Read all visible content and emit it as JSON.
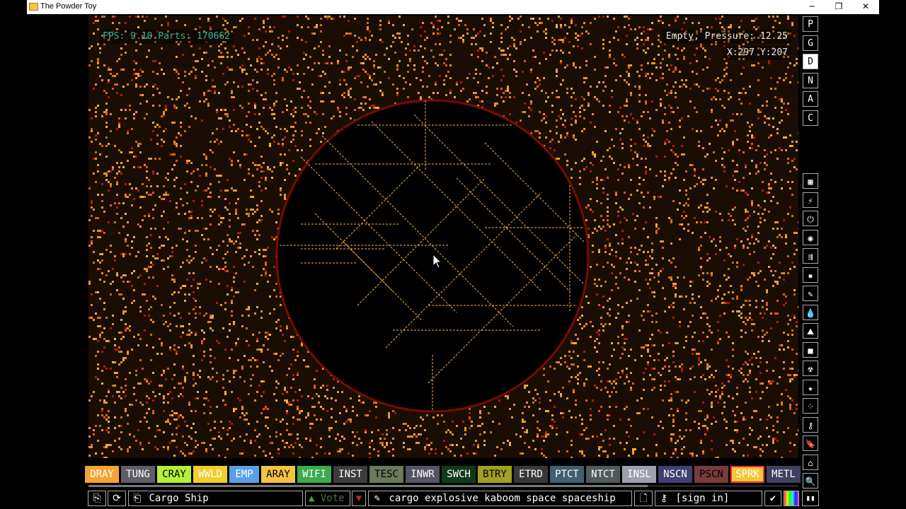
{
  "window": {
    "title": "The Powder Toy",
    "minimize": "─",
    "restore": "❐",
    "close": "✕"
  },
  "hud": {
    "fps_text": "FPS: 9.10 Parts: 170662",
    "info_text": "Empty, Pressure: 12.25",
    "coords_text": "X:297 Y:207"
  },
  "right_toolbar": {
    "modes": [
      "P",
      "G",
      "D",
      "N",
      "A",
      "C"
    ],
    "selected_mode": "D",
    "categories": [
      {
        "name": "walls-icon",
        "glyph": "▦"
      },
      {
        "name": "electronics-icon",
        "glyph": "⚡"
      },
      {
        "name": "powered-icon",
        "glyph": "⏻"
      },
      {
        "name": "sensors-icon",
        "glyph": "◉"
      },
      {
        "name": "force-icon",
        "glyph": "⇶"
      },
      {
        "name": "explosives-icon",
        "glyph": "✸"
      },
      {
        "name": "gases-icon",
        "glyph": "✎"
      },
      {
        "name": "liquids-icon",
        "glyph": "💧"
      },
      {
        "name": "powders-icon",
        "glyph": "⛰"
      },
      {
        "name": "solids-icon",
        "glyph": "■"
      },
      {
        "name": "radioactive-icon",
        "glyph": "☢"
      },
      {
        "name": "special-icon",
        "glyph": "★"
      },
      {
        "name": "life-icon",
        "glyph": "⁘"
      },
      {
        "name": "tools-icon",
        "glyph": "⚷"
      },
      {
        "name": "favorites-icon",
        "glyph": "🔖"
      },
      {
        "name": "recent-icon",
        "glyph": "⌂"
      },
      {
        "name": "search-icon",
        "glyph": "🔍"
      }
    ]
  },
  "elements": [
    {
      "label": "DRAY",
      "bg": "#f5a434",
      "fg": "#ffffff"
    },
    {
      "label": "TUNG",
      "bg": "#5e5e6a",
      "fg": "#ffffff"
    },
    {
      "label": "CRAY",
      "bg": "#b6f038",
      "fg": "#000000"
    },
    {
      "label": "WWLD",
      "bg": "#f0d028",
      "fg": "#ffffff"
    },
    {
      "label": "EMP",
      "bg": "#5aa0e6",
      "fg": "#ffffff"
    },
    {
      "label": "ARAY",
      "bg": "#f5c342",
      "fg": "#000000"
    },
    {
      "label": "WIFI",
      "bg": "#3caa4e",
      "fg": "#ffffff"
    },
    {
      "label": "INST",
      "bg": "#3c3c3c",
      "fg": "#ffffff"
    },
    {
      "label": "TESC",
      "bg": "#6a7a5a",
      "fg": "#000000"
    },
    {
      "label": "INWR",
      "bg": "#545466",
      "fg": "#ffffff"
    },
    {
      "label": "SWCH",
      "bg": "#113a1a",
      "fg": "#ffffff"
    },
    {
      "label": "BTRY",
      "bg": "#a0a024",
      "fg": "#000000"
    },
    {
      "label": "ETRD",
      "bg": "#383838",
      "fg": "#ffffff"
    },
    {
      "label": "PTCT",
      "bg": "#406070",
      "fg": "#ffffff"
    },
    {
      "label": "NTCT",
      "bg": "#505a5a",
      "fg": "#ffffff"
    },
    {
      "label": "INSL",
      "bg": "#9ea0ae",
      "fg": "#ffffff"
    },
    {
      "label": "NSCN",
      "bg": "#404072",
      "fg": "#ffffff"
    },
    {
      "label": "PSCN",
      "bg": "#7a3c3c",
      "fg": "#000000"
    },
    {
      "label": "SPRK",
      "bg": "#f2c83a",
      "fg": "#ffffff",
      "selected": true
    },
    {
      "label": "METL",
      "bg": "#404060",
      "fg": "#ffffff"
    }
  ],
  "bottom_bar": {
    "open_icon": "⎘",
    "reload_icon": "⟳",
    "save_icon": "⎗",
    "save_name": "Cargo Ship",
    "vote_up_icon": "▲",
    "vote_label": "Vote",
    "vote_down_icon": "▼",
    "tag_icon": "✎",
    "tags": "cargo explosive kaboom space spaceship",
    "page_icon": "🗋",
    "user_icon": "⚷",
    "sign_in": "[sign in]",
    "checkmark_icon": "✔",
    "pause_icon": "▮▮"
  },
  "colors": {
    "orange": "#f0922a",
    "deep_orange": "#e05a12",
    "red": "#b01a08",
    "spark_line": "#f7b24c"
  }
}
